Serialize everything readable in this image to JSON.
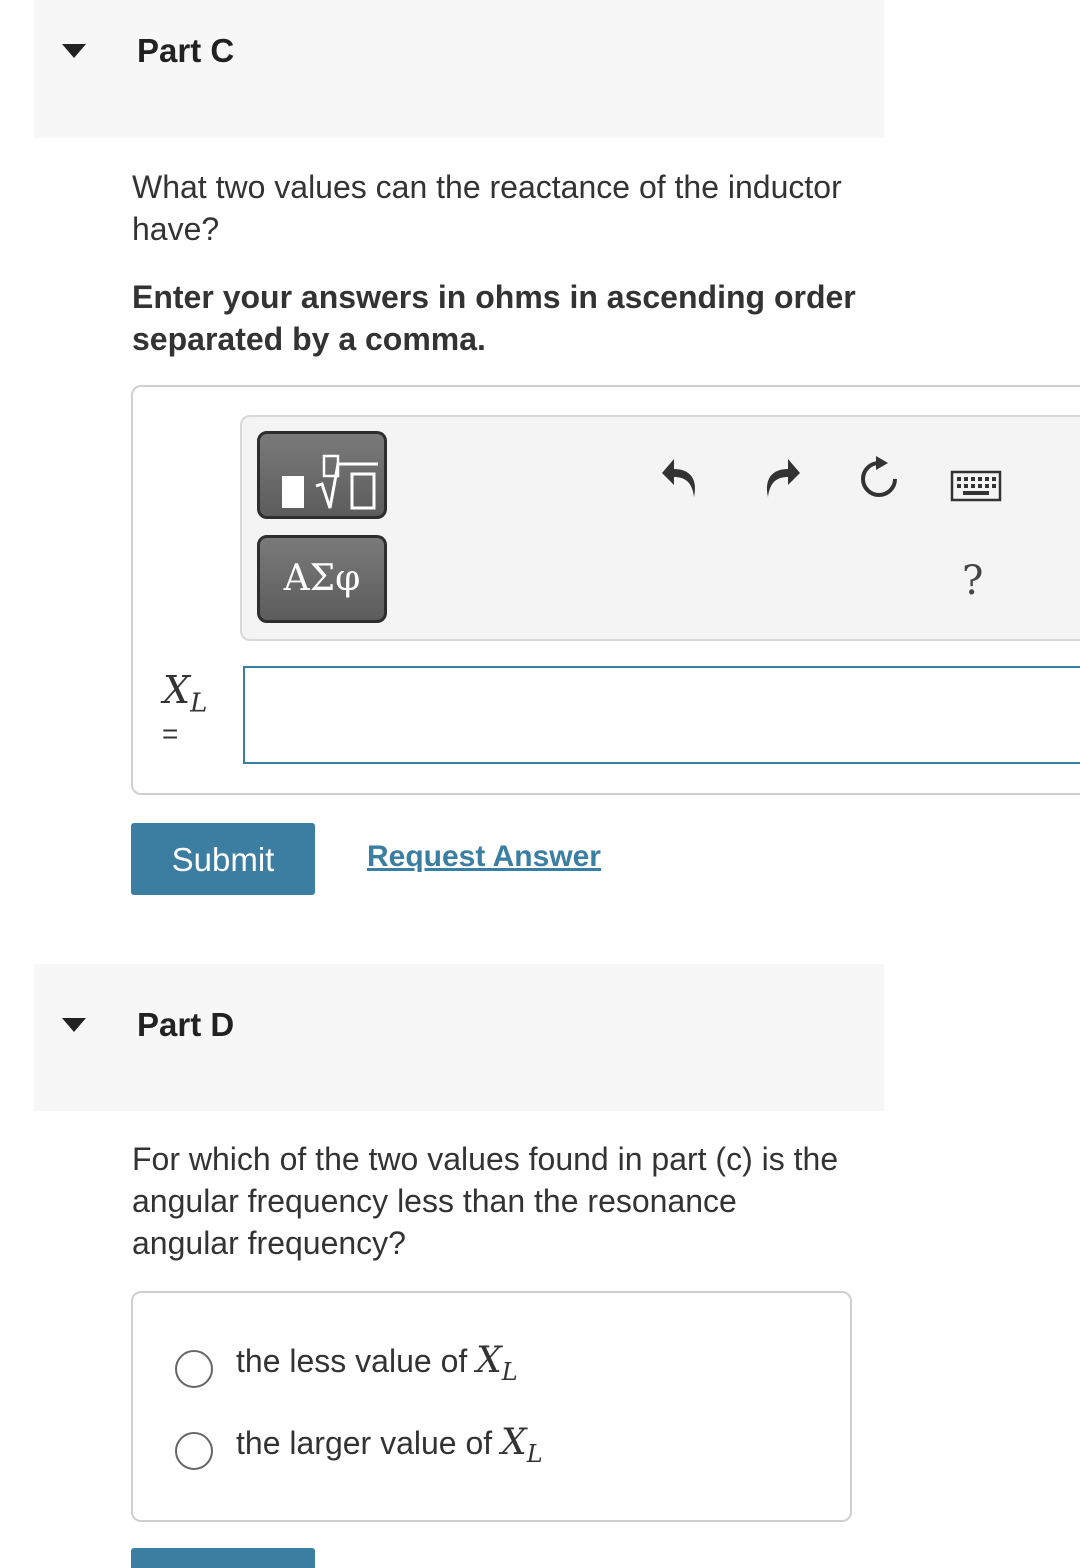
{
  "part_c": {
    "header": "Part C",
    "question": "What two values can the reactance of the inductor have?",
    "instruction": "Enter your answers in ohms in ascending order separated by a comma.",
    "toolbar": {
      "greek_label": "ΑΣφ",
      "help_label": "?"
    },
    "variable": {
      "symbol": "X",
      "subscript": "L",
      "equals": "="
    },
    "input_value": "",
    "submit_label": "Submit",
    "request_answer_label": "Request Answer"
  },
  "part_d": {
    "header": "Part D",
    "question": "For which of the two values found in part (c) is the angular frequency less than the resonance angular frequency?",
    "choices": [
      {
        "text": "the less value of ",
        "symbol": "X",
        "subscript": "L"
      },
      {
        "text": "the larger value of ",
        "symbol": "X",
        "subscript": "L"
      }
    ]
  },
  "colors": {
    "accent": "#3b7ea1",
    "header_bg": "#f7f7f7",
    "toolbar_bg": "#f4f4f4"
  },
  "icons": [
    "collapse-triangle-icon",
    "templates-icon",
    "undo-icon",
    "redo-icon",
    "reset-icon",
    "keyboard-icon"
  ]
}
